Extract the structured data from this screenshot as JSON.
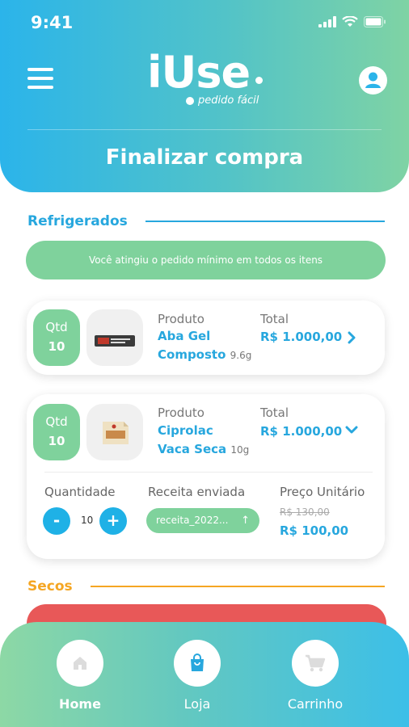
{
  "status_bar": {
    "time": "9:41"
  },
  "header": {
    "logo_text": "iUse",
    "logo_subtitle": "pedido fácil",
    "title": "Finalizar compra"
  },
  "sections": [
    {
      "title": "Refrigerados",
      "color": "#27a7de",
      "min_order_message": "Você atingiu o pedido mínimo em todos os itens",
      "items": [
        {
          "qty_label": "Qtd",
          "qty": "10",
          "product_label": "Produto",
          "name_line1": "Aba Gel",
          "name_line2": "Composto",
          "weight": "9.6g",
          "total_label": "Total",
          "total": "R$ 1.000,00",
          "expanded": false
        },
        {
          "qty_label": "Qtd",
          "qty": "10",
          "product_label": "Produto",
          "name_line1": "Ciprolac",
          "name_line2": "Vaca Seca",
          "weight": "10g",
          "total_label": "Total",
          "total": "R$ 1.000,00",
          "expanded": true,
          "details": {
            "quantity_label": "Quantidade",
            "minus": "-",
            "plus": "+",
            "quantity": "10",
            "receipt_label": "Receita enviada",
            "receipt_file": "receita_2022...",
            "unit_price_label": "Preço Unitário",
            "old_price": "R$ 130,00",
            "unit_price": "R$ 100,00"
          }
        }
      ]
    },
    {
      "title": "Secos",
      "color": "#f5a623"
    }
  ],
  "bottom_nav": [
    {
      "label": "Home",
      "icon": "home-icon",
      "active": true
    },
    {
      "label": "Loja",
      "icon": "shopping-bag-icon",
      "active": false
    },
    {
      "label": "Carrinho",
      "icon": "cart-icon",
      "active": false
    }
  ],
  "colors": {
    "primary_blue": "#27a7de",
    "green": "#7fd29c",
    "orange": "#f5a623",
    "alert_red": "#e85858"
  }
}
